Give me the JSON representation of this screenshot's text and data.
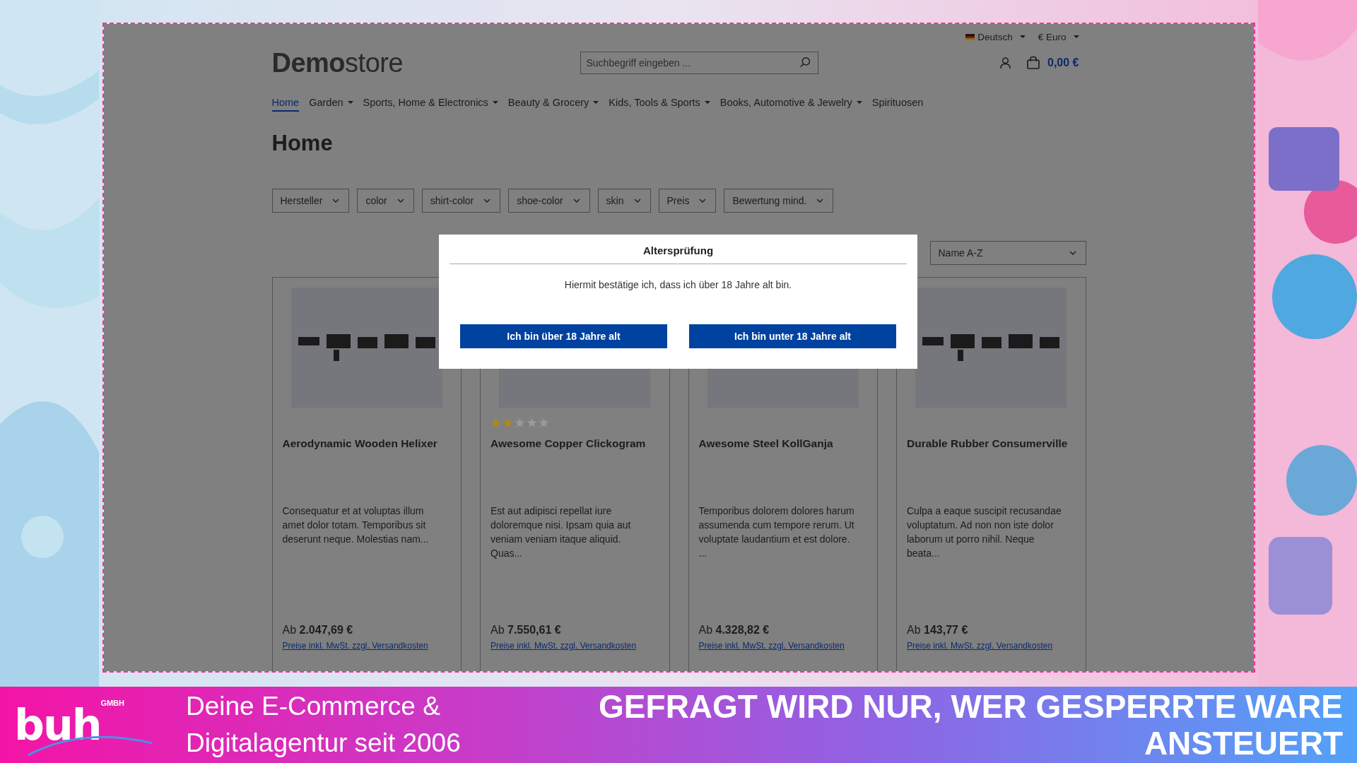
{
  "topbar": {
    "language": "Deutsch",
    "currency": "€ Euro"
  },
  "header": {
    "logo_bold": "Demo",
    "logo_light": "store",
    "search": {
      "placeholder": "Suchbegriff eingeben ..."
    },
    "cart_total": "0,00 €"
  },
  "nav": [
    {
      "label": "Home",
      "selected": true,
      "dropdown": false
    },
    {
      "label": "Garden",
      "selected": false,
      "dropdown": true
    },
    {
      "label": "Sports, Home & Electronics",
      "selected": false,
      "dropdown": true
    },
    {
      "label": "Beauty & Grocery",
      "selected": false,
      "dropdown": true
    },
    {
      "label": "Kids, Tools & Sports",
      "selected": false,
      "dropdown": true
    },
    {
      "label": "Books, Automotive & Jewelry",
      "selected": false,
      "dropdown": true
    },
    {
      "label": "Spirituosen",
      "selected": false,
      "dropdown": false
    }
  ],
  "page_title": "Home",
  "filters": [
    "Hersteller",
    "color",
    "shirt-color",
    "shoe-color",
    "skin",
    "Preis",
    "Bewertung mind."
  ],
  "sort": "Name A-Z",
  "products": [
    {
      "name": "Aerodynamic Wooden Helixer",
      "description": "Consequatur et at voluptas illum amet dolor totam. Temporibus sit deserunt neque. Molestias nam...",
      "price_prefix": "Ab",
      "price": "2.047,69 €",
      "note": "Preise inkl. MwSt. zzgl. Versandkosten"
    },
    {
      "name": "Awesome Copper Clickogram",
      "stars": 2,
      "description": "Est aut adipisci repellat iure doloremque nisi. Ipsam quia aut veniam veniam itaque aliquid. Quas...",
      "price_prefix": "Ab",
      "price": "7.550,61 €",
      "note": "Preise inkl. MwSt. zzgl. Versandkosten"
    },
    {
      "name": "Awesome Steel KollGanja",
      "description": "Temporibus dolorem dolores harum assumenda cum tempore rerum. Ut voluptate laudantium et est dolore. ...",
      "price_prefix": "Ab",
      "price": "4.328,82 €",
      "note": "Preise inkl. MwSt. zzgl. Versandkosten"
    },
    {
      "name": "Durable Rubber Consumerville",
      "description": "Culpa a eaque suscipit recusandae voluptatum. Ad non non iste dolor laborum ut porro nihil. Neque beata...",
      "price_prefix": "Ab",
      "price": "143,77 €",
      "note": "Preise inkl. MwSt. zzgl. Versandkosten"
    }
  ],
  "modal": {
    "title": "Altersprüfung",
    "text": "Hiermit bestätige ich, dass ich über 18 Jahre alt bin.",
    "buttons": [
      "Ich bin über 18 Jahre alt",
      "Ich bin unter 18 Jahre alt"
    ]
  },
  "banner": {
    "logo": "buh",
    "logo_suffix": "GMBH",
    "slogan": [
      "Deine E-Commerce &",
      "Digitalagentur seit 2006"
    ],
    "headline": [
      "GEFRAGT WIRD NUR, WER GESPERRTE WARE",
      "ANSTEUERT"
    ]
  }
}
